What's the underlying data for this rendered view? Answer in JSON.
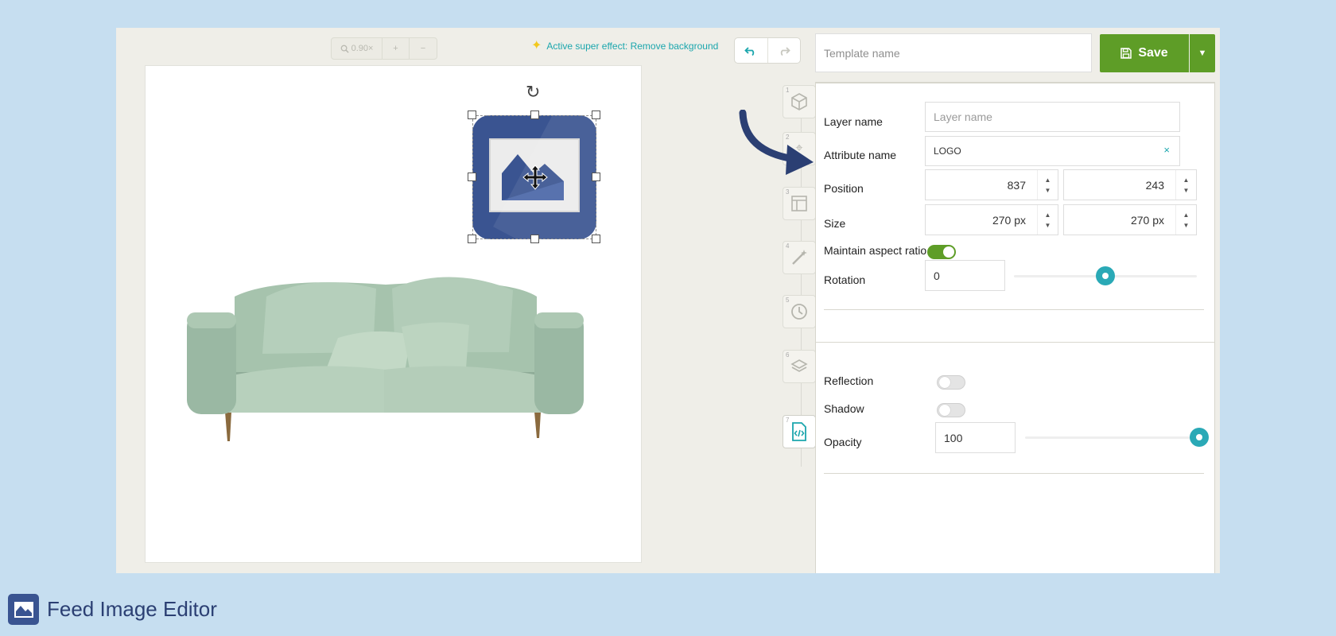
{
  "toolbar": {
    "zoom_level": "0.90×",
    "zoom_in": "+",
    "zoom_out": "−",
    "effect_note": "Active super effect: Remove background",
    "undo_icon": "undo-icon",
    "redo_icon": "redo-icon",
    "template_name_placeholder": "Template name",
    "template_name_value": "",
    "save_label": "Save"
  },
  "canvas": {
    "background_color": "#ffffff",
    "logo_color": "#3a5491"
  },
  "tabs": [
    {
      "num": "1",
      "icon": "cube-icon"
    },
    {
      "num": "2",
      "icon": "tag-icon"
    },
    {
      "num": "3",
      "icon": "layout-icon"
    },
    {
      "num": "4",
      "icon": "magic-wand-icon"
    },
    {
      "num": "5",
      "icon": "clock-icon"
    },
    {
      "num": "6",
      "icon": "layers-icon"
    },
    {
      "num": "7",
      "icon": "code-file-icon"
    }
  ],
  "panel": {
    "layer_name_label": "Layer name",
    "layer_name_placeholder": "Layer name",
    "attribute_name_label": "Attribute name",
    "attribute_name_value": "LOGO",
    "clear_symbol": "×",
    "position_label": "Position",
    "position_x": "837",
    "position_y": "243",
    "size_label": "Size",
    "size_w": "270 px",
    "size_h": "270 px",
    "aspect_label": "Maintain aspect ratio",
    "aspect_on": true,
    "rotation_label": "Rotation",
    "rotation_value": "0",
    "rotation_fraction": 0.5,
    "reflection_label": "Reflection",
    "reflection_on": false,
    "shadow_label": "Shadow",
    "shadow_on": false,
    "opacity_label": "Opacity",
    "opacity_value": "100",
    "opacity_fraction": 1.0
  },
  "brand": {
    "name": "Feed Image Editor",
    "color": "#2b3f73"
  },
  "colors": {
    "accent": "#1ba6ad",
    "save_green": "#5e9d27",
    "page_bg": "#c6def0"
  }
}
